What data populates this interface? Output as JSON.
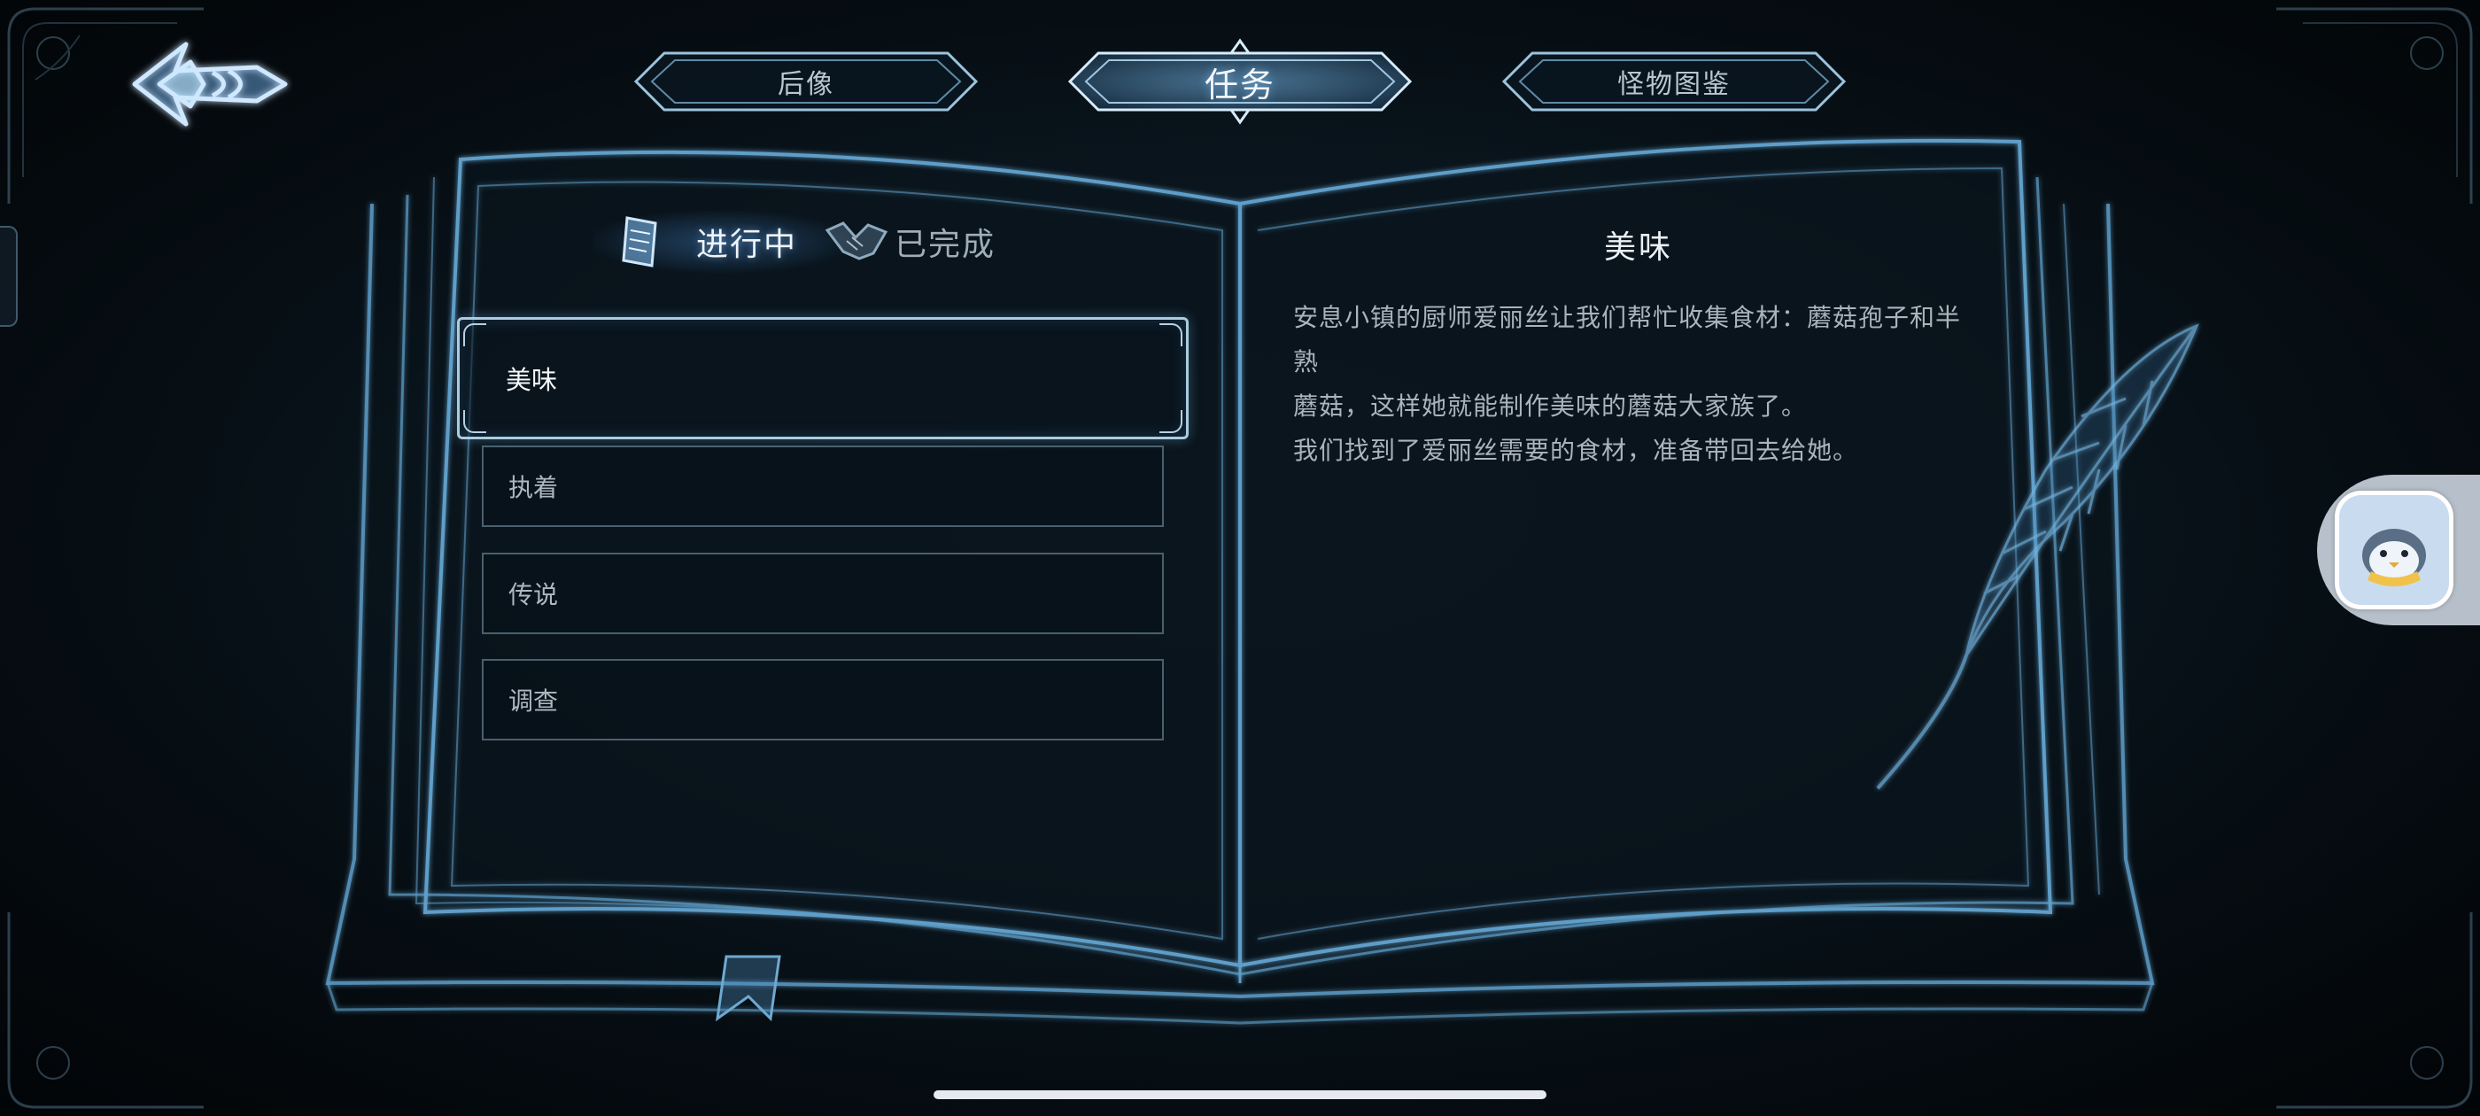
{
  "top_tabs": [
    {
      "label": "后像",
      "active": false
    },
    {
      "label": "任务",
      "active": true
    },
    {
      "label": "怪物图鉴",
      "active": false
    }
  ],
  "status_tabs": {
    "in_progress": "进行中",
    "completed": "已完成",
    "selected": "in_progress"
  },
  "quests": [
    {
      "title": "美味",
      "selected": true
    },
    {
      "title": "执着",
      "selected": false
    },
    {
      "title": "传说",
      "selected": false
    },
    {
      "title": "调查",
      "selected": false
    }
  ],
  "detail": {
    "title": "美味",
    "line1": "安息小镇的厨师爱丽丝让我们帮忙收集食材：蘑菇孢子和半熟",
    "line2": "蘑菇，这样她就能制作美味的蘑菇大家族了。",
    "line3": "我们找到了爱丽丝需要的食材，准备带回去给她。"
  },
  "icons": {
    "back": "back-arrow-icon",
    "in_progress": "scroll-icon",
    "completed": "handshake-icon",
    "assistant": "penguin-assistant-icon"
  },
  "colors": {
    "accent_glow": "#8cc8ff",
    "frame_blue": "#5e9ec8",
    "background": "#081219"
  }
}
